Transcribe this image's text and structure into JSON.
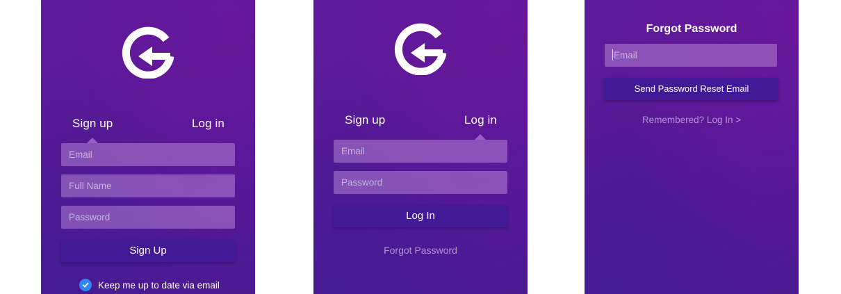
{
  "colors": {
    "panel_gradient_start": "#5e1a9e",
    "panel_gradient_end": "#4d1a92",
    "button_bg": "#431a96",
    "input_bg": "#a77fcf",
    "checkbox": "#2f86f5"
  },
  "signup_screen": {
    "logo_icon": "g-arrow-logo-icon",
    "tab_signup": "Sign up",
    "tab_login": "Log in",
    "active_tab": "Sign up",
    "email_placeholder": "Email",
    "fullname_placeholder": "Full Name",
    "password_placeholder": "Password",
    "submit_label": "Sign Up",
    "newsletter_label": "Keep me up to date via email",
    "newsletter_checked": true
  },
  "login_screen": {
    "logo_icon": "g-arrow-logo-icon",
    "tab_signup": "Sign up",
    "tab_login": "Log in",
    "active_tab": "Log in",
    "email_placeholder": "Email",
    "password_placeholder": "Password",
    "submit_label": "Log In",
    "forgot_link": "Forgot Password"
  },
  "forgot_screen": {
    "title": "Forgot Password",
    "email_placeholder": "Email",
    "submit_label": "Send Password Reset Email",
    "back_link": "Remembered? Log In >"
  }
}
